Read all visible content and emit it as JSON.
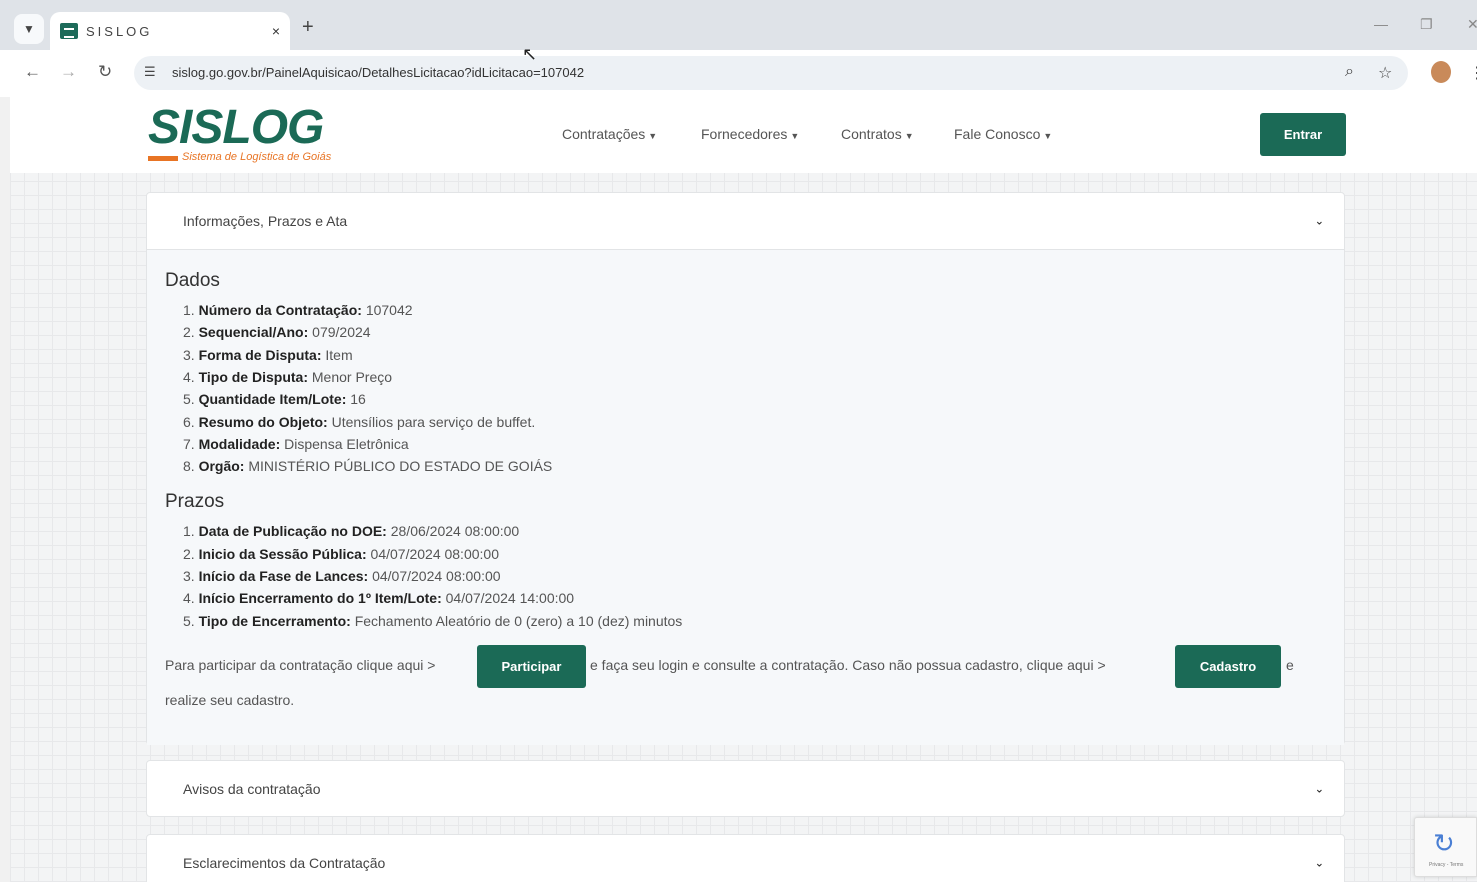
{
  "browser": {
    "tab_title": "SISLOG",
    "tab_close": "×",
    "new_tab": "+",
    "url": "sislog.go.gov.br/PainelAquisicao/DetalhesLicitacao?idLicitacao=107042"
  },
  "header": {
    "logo_text": "SISLOG",
    "logo_subtitle": "Sistema de Logística de Goiás",
    "nav": [
      {
        "label": "Contratações"
      },
      {
        "label": "Fornecedores"
      },
      {
        "label": "Contratos"
      },
      {
        "label": "Fale Conosco"
      }
    ],
    "login_label": "Entrar"
  },
  "main_card": {
    "header": "Informações, Prazos e Ata",
    "dados_title": "Dados",
    "dados": [
      {
        "num": "1.",
        "label": "Número da Contratação:",
        "value": "107042"
      },
      {
        "num": "2.",
        "label": "Sequencial/Ano:",
        "value": "079/2024"
      },
      {
        "num": "3.",
        "label": "Forma de Disputa:",
        "value": "Item"
      },
      {
        "num": "4.",
        "label": "Tipo de Disputa:",
        "value": "Menor Preço"
      },
      {
        "num": "5.",
        "label": "Quantidade Item/Lote:",
        "value": "16"
      },
      {
        "num": "6.",
        "label": "Resumo do Objeto:",
        "value": "Utensílios para serviço de buffet."
      },
      {
        "num": "7.",
        "label": "Modalidade:",
        "value": "Dispensa Eletrônica"
      },
      {
        "num": "8.",
        "label": "Orgão:",
        "value": "MINISTÉRIO PÚBLICO DO ESTADO DE GOIÁS"
      }
    ],
    "prazos_title": "Prazos",
    "prazos": [
      {
        "num": "1.",
        "label": "Data de Publicação no DOE:",
        "value": "28/06/2024 08:00:00"
      },
      {
        "num": "2.",
        "label": "Inicio da Sessão Pública:",
        "value": "04/07/2024 08:00:00"
      },
      {
        "num": "3.",
        "label": "Início da Fase de Lances:",
        "value": "04/07/2024 08:00:00"
      },
      {
        "num": "4.",
        "label": "Início Encerramento do 1º Item/Lote:",
        "value": "04/07/2024 14:00:00"
      },
      {
        "num": "5.",
        "label": "Tipo de Encerramento:",
        "value": "Fechamento Aleatório de 0 (zero) a 10 (dez) minutos"
      }
    ],
    "participar_text_1": "Para participar da contratação clique aqui >",
    "participar_button": "Participar",
    "participar_text_2": "e faça seu login e consulte a contratação. Caso não possua cadastro, clique aqui >",
    "cadastro_button": "Cadastro",
    "participar_text_3": "e",
    "participar_text_4": "realize seu cadastro."
  },
  "avisos_card": {
    "header": "Avisos da contratação"
  },
  "esclarecimentos_card": {
    "header": "Esclarecimentos da Contratação"
  },
  "recaptcha": {
    "footer": "Privacy - Terms"
  }
}
